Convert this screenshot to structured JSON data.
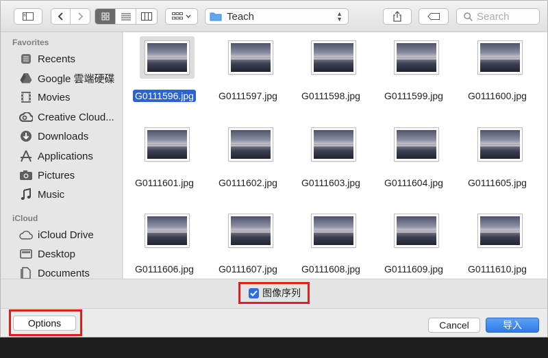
{
  "toolbar": {
    "path_folder": "Teach",
    "search_placeholder": "Search"
  },
  "sidebar": {
    "sections": [
      {
        "header": "Favorites",
        "items": [
          {
            "label": "Recents",
            "icon": "recents-icon"
          },
          {
            "label": "Google 雲端硬碟",
            "icon": "google-drive-icon"
          },
          {
            "label": "Movies",
            "icon": "movies-icon"
          },
          {
            "label": "Creative Cloud...",
            "icon": "creative-cloud-icon"
          },
          {
            "label": "Downloads",
            "icon": "downloads-icon"
          },
          {
            "label": "Applications",
            "icon": "applications-icon"
          },
          {
            "label": "Pictures",
            "icon": "pictures-icon"
          },
          {
            "label": "Music",
            "icon": "music-icon"
          }
        ]
      },
      {
        "header": "iCloud",
        "items": [
          {
            "label": "iCloud Drive",
            "icon": "cloud-icon"
          },
          {
            "label": "Desktop",
            "icon": "desktop-icon"
          },
          {
            "label": "Documents",
            "icon": "documents-icon"
          }
        ]
      }
    ]
  },
  "files": [
    "G0111596.jpg",
    "G0111597.jpg",
    "G0111598.jpg",
    "G0111599.jpg",
    "G0111600.jpg",
    "G0111601.jpg",
    "G0111602.jpg",
    "G0111603.jpg",
    "G0111604.jpg",
    "G0111605.jpg",
    "G0111606.jpg",
    "G0111607.jpg",
    "G0111608.jpg",
    "G0111609.jpg",
    "G0111610.jpg"
  ],
  "selected_file": "G0111596.jpg",
  "accessory": {
    "image_sequence_label": "图像序列",
    "image_sequence_checked": true
  },
  "buttons": {
    "options": "Options",
    "cancel": "Cancel",
    "import": "导入"
  },
  "colors": {
    "selection": "#2a63d4",
    "highlight_border": "#e01e1e",
    "primary_button": "#2f7ae9"
  }
}
